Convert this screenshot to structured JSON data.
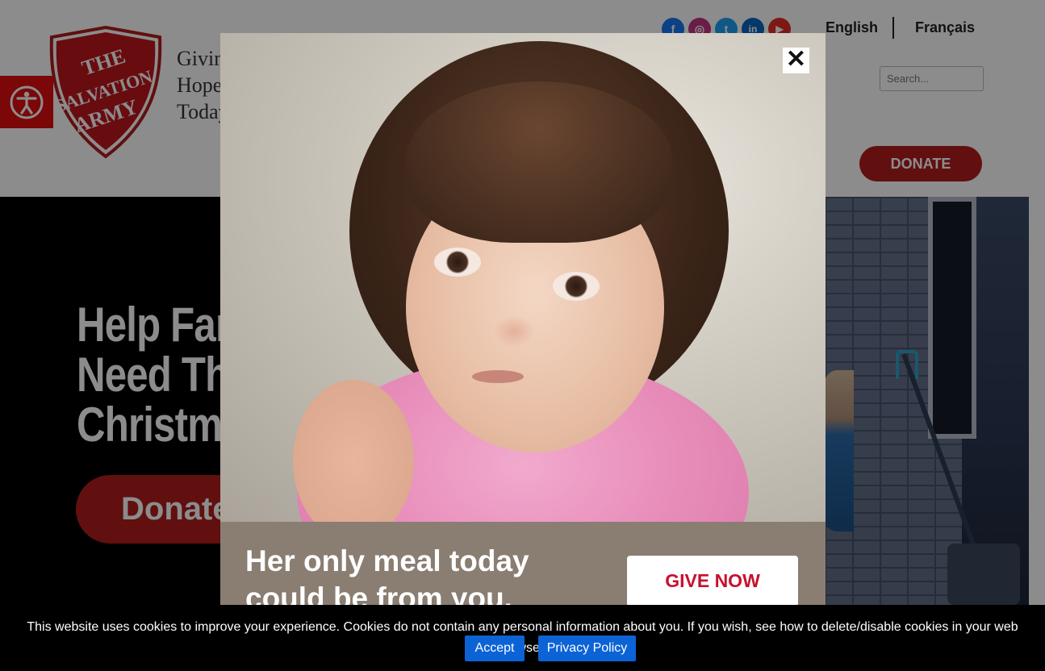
{
  "header": {
    "tagline_lines": [
      "Giving",
      "Hope",
      "Today"
    ],
    "social": [
      {
        "name": "facebook-icon",
        "glyph": "f",
        "color": "#1877f2"
      },
      {
        "name": "instagram-icon",
        "glyph": "◎",
        "color": "#c13584"
      },
      {
        "name": "twitter-icon",
        "glyph": "t",
        "color": "#1da1f2"
      },
      {
        "name": "linkedin-icon",
        "glyph": "in",
        "color": "#0a66c2"
      },
      {
        "name": "youtube-icon",
        "glyph": "▶",
        "color": "#e52d27"
      }
    ],
    "lang_english": "English",
    "lang_french": "Français",
    "search_placeholder": "Search...",
    "donate_label": "DONATE"
  },
  "hero": {
    "title_lines": [
      "Help Families",
      "Need This",
      "Christmas"
    ],
    "donate_label": "Donate"
  },
  "popup": {
    "headline": "Her only meal today could be from you.",
    "give_label": "GIVE NOW",
    "close_glyph": "✕"
  },
  "cookie": {
    "text": "This website uses cookies to improve your experience. Cookies do not contain any personal information about you. If you wish, see how to delete/disable cookies in your web browser.",
    "accept_label": "Accept",
    "privacy_label": "Privacy Policy"
  },
  "colors": {
    "brand_red": "#b11d1d",
    "accessibility_red": "#e10e10",
    "cookie_button_blue": "#0b63d6"
  }
}
